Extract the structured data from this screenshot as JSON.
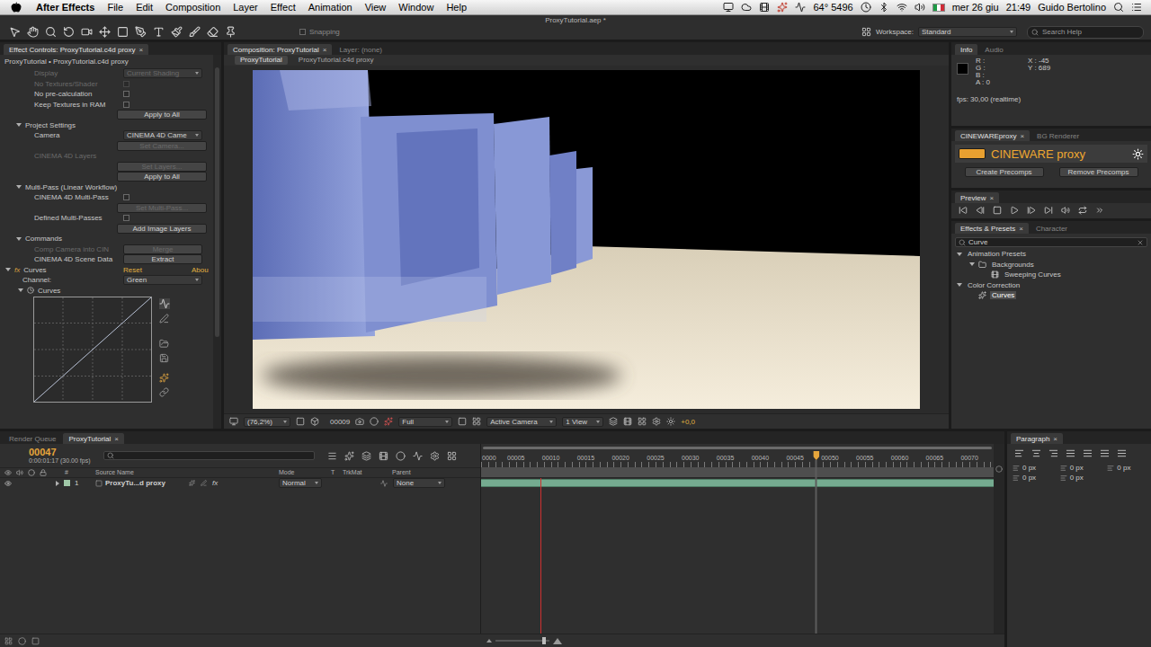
{
  "menu_bar": {
    "app": "After Effects",
    "items": [
      "File",
      "Edit",
      "Composition",
      "Layer",
      "Effect",
      "Animation",
      "View",
      "Window",
      "Help"
    ],
    "status": "64° 5496",
    "date": "mer 26 giu",
    "time": "21:49",
    "user": "Guido Bertolino"
  },
  "window": {
    "title": "ProxyTutorial.aep *"
  },
  "toolbar": {
    "snapping": {
      "label": "Snapping",
      "checked": false
    },
    "workspace_label": "Workspace:",
    "workspace": "Standard",
    "search_placeholder": "Search Help"
  },
  "effect_controls": {
    "tabs": [
      {
        "label": "Effect Controls: ProxyTutorial.c4d proxy",
        "close": "×",
        "selected": true
      }
    ],
    "breadcrumb": "ProxyTutorial • ProxyTutorial.c4d proxy",
    "rows": [
      {
        "kind": "dropdown",
        "label": "Display",
        "value": "Current Shading",
        "disabled": true
      },
      {
        "kind": "checkbox",
        "label": "No Textures/Shader",
        "checked": false,
        "disabled": true
      },
      {
        "kind": "checkbox",
        "label": "No pre-calculation",
        "checked": false,
        "disabled": false
      },
      {
        "kind": "checkbox",
        "label": "Keep Textures in RAM",
        "checked": false,
        "disabled": false
      },
      {
        "kind": "button",
        "value": "Apply to All",
        "disabled": false
      },
      {
        "kind": "section",
        "label": "Project Settings",
        "expanded": true,
        "disabled": false
      },
      {
        "kind": "dropdown",
        "label": "Camera",
        "value": "CINEMA 4D Came",
        "disabled": false
      },
      {
        "kind": "button",
        "value": "Set Camera...",
        "disabled": true
      },
      {
        "kind": "text",
        "label": "CINEMA 4D Layers",
        "disabled": true
      },
      {
        "kind": "button",
        "value": "Set Layers...",
        "disabled": true
      },
      {
        "kind": "button",
        "value": "Apply to All",
        "disabled": false
      },
      {
        "kind": "section",
        "label": "Multi-Pass (Linear Workflow)",
        "expanded": true,
        "disabled": false
      },
      {
        "kind": "checkbox",
        "label": "CINEMA 4D Multi-Pass",
        "checked": false,
        "disabled": false
      },
      {
        "kind": "button",
        "value": "Set Multi-Pass...",
        "disabled": true
      },
      {
        "kind": "checkbox",
        "label": "Defined Multi-Passes",
        "checked": false,
        "disabled": false
      },
      {
        "kind": "button",
        "value": "Add Image Layers",
        "disabled": false
      },
      {
        "kind": "section",
        "label": "Commands",
        "expanded": true,
        "disabled": false
      },
      {
        "kind": "labeled-button",
        "label": "Comp Camera into CIN",
        "value": "Merge",
        "disabled": true
      },
      {
        "kind": "labeled-button",
        "label": "CINEMA 4D Scene Data",
        "value": "Extract",
        "disabled": false
      }
    ],
    "effect": {
      "fx": "fx",
      "name": "Curves",
      "reset": "Reset",
      "about": "Abou",
      "expanded": true,
      "channel_label": "Channel:",
      "channel": "Green",
      "curves_label": "Curves",
      "curves_expanded": true
    }
  },
  "composition": {
    "tabs": [
      {
        "label": "Composition: ProxyTutorial",
        "close": "×",
        "selected": true
      },
      {
        "label": "Layer: (none)",
        "selected": false
      }
    ],
    "subtabs": [
      {
        "label": "ProxyTutorial",
        "selected": true
      },
      {
        "label": "ProxyTutorial.c4d proxy",
        "selected": false
      }
    ],
    "footer": {
      "zoom": "(76,2%)",
      "frame": "00009",
      "resolution": "Full",
      "camera": "Active Camera",
      "views": "1 View",
      "exposure": "+0,0"
    }
  },
  "info": {
    "tabs": [
      {
        "label": "Info",
        "selected": true
      },
      {
        "label": "Audio",
        "selected": false
      }
    ],
    "rgba": [
      "R :",
      "G :",
      "B :",
      "A : 0"
    ],
    "coords": [
      "X : -45",
      "Y : 689"
    ],
    "fps": "fps: 30,00 (realtime)"
  },
  "cineware": {
    "tabs": [
      {
        "label": "CINEWAREproxy",
        "close": "×",
        "selected": true
      },
      {
        "label": "BG Renderer",
        "selected": false
      }
    ],
    "logo": "CINEWARE proxy",
    "buttons": [
      "Create Precomps",
      "Remove Precomps"
    ]
  },
  "preview": {
    "tabs": [
      {
        "label": "Preview",
        "close": "×",
        "selected": true
      }
    ]
  },
  "effects_presets": {
    "tabs": [
      {
        "label": "Effects & Presets",
        "close": "×",
        "selected": true
      },
      {
        "label": "Character",
        "selected": false
      }
    ],
    "search": "Curve",
    "items": [
      {
        "label": "Animation Presets",
        "depth": 0,
        "kind": "category",
        "expanded": true,
        "selected": false
      },
      {
        "label": "Backgrounds",
        "depth": 1,
        "kind": "folder",
        "expanded": true,
        "selected": false
      },
      {
        "label": "Sweeping Curves",
        "depth": 2,
        "kind": "preset",
        "selected": false
      },
      {
        "label": "Color Correction",
        "depth": 0,
        "kind": "category",
        "expanded": true,
        "selected": false
      },
      {
        "label": "Curves",
        "depth": 1,
        "kind": "effect",
        "selected": true
      }
    ]
  },
  "timeline": {
    "tabs": [
      {
        "label": "Render Queue",
        "selected": false
      },
      {
        "label": "ProxyTutorial",
        "close": "×",
        "selected": true
      }
    ],
    "timecode": "00047",
    "timecode_sub": "0:00:01:17 (30.00 fps)",
    "columns": [
      "#",
      "Source Name",
      "Mode",
      "T",
      "TrkMat",
      "Parent"
    ],
    "layers": [
      {
        "index": "1",
        "name": "ProxyTu...d proxy",
        "fx": "fx",
        "mode": "Normal",
        "parent": "None",
        "visible": true,
        "selected": false,
        "bar_start": 0,
        "bar_end": 1
      }
    ],
    "ruler": [
      "0000",
      "00005",
      "00010",
      "00015",
      "00020",
      "00025",
      "00030",
      "00035",
      "00040",
      "00045",
      "00050",
      "00055",
      "00060",
      "00065",
      "00070"
    ],
    "playhead": {
      "level": 0.654
    },
    "marker": {
      "level": 0.115
    },
    "zoom": {
      "level": 0.9
    }
  },
  "paragraph": {
    "tabs": [
      {
        "label": "Paragraph",
        "close": "×",
        "selected": true
      }
    ],
    "fields": [
      "0 px",
      "0 px",
      "0 px",
      "0 px",
      "0 px"
    ]
  }
}
